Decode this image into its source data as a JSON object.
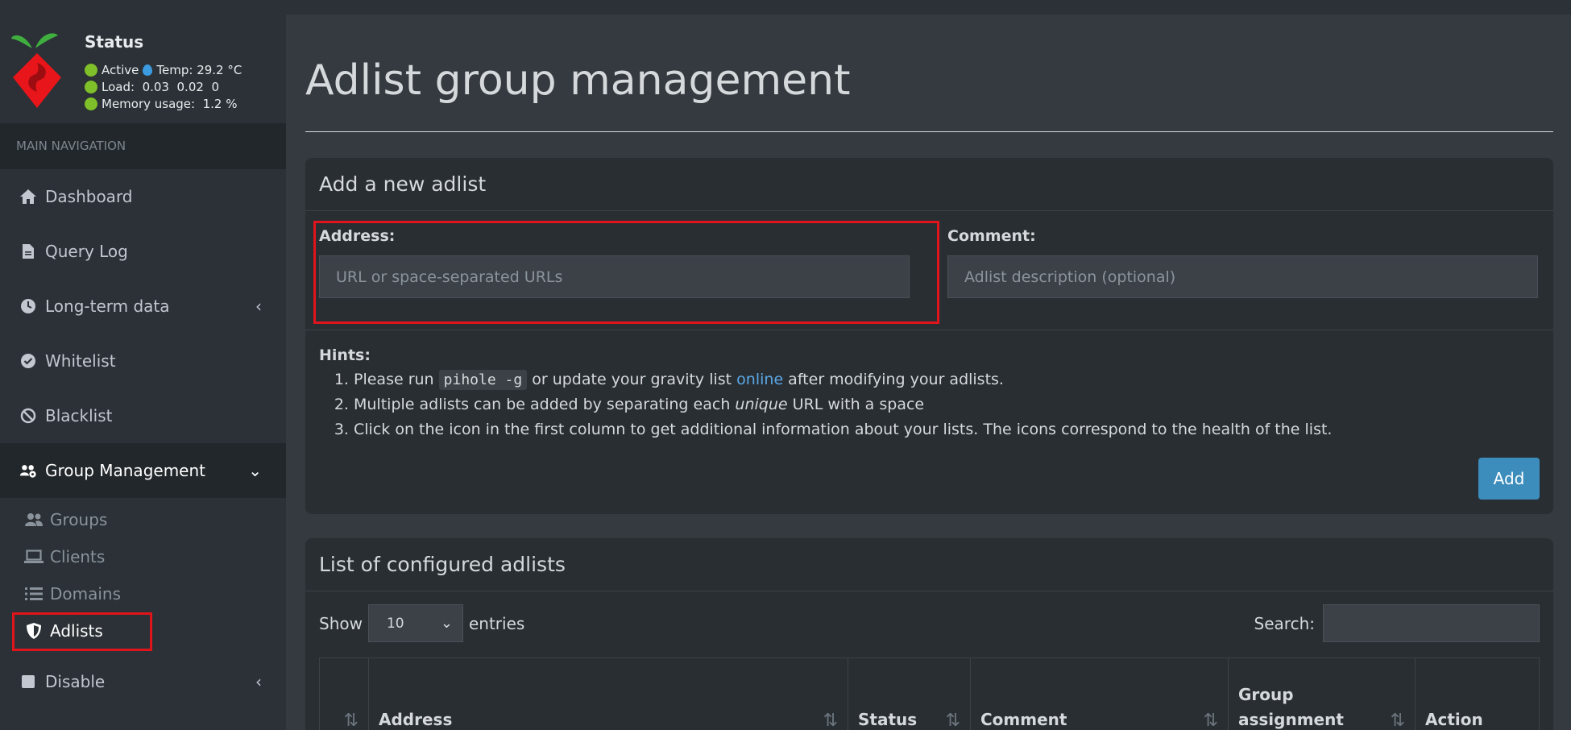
{
  "sidebar": {
    "status": {
      "title": "Status",
      "active": "Active",
      "temp": "Temp: 29.2 °C",
      "load": "Load:  0.03  0.02  0",
      "memory": "Memory usage:  1.2 %"
    },
    "nav_header": "MAIN NAVIGATION",
    "items": [
      {
        "label": "Dashboard",
        "icon": "home-icon"
      },
      {
        "label": "Query Log",
        "icon": "file-icon"
      },
      {
        "label": "Long-term data",
        "icon": "clock-icon"
      },
      {
        "label": "Whitelist",
        "icon": "check-circle-icon"
      },
      {
        "label": "Blacklist",
        "icon": "ban-icon"
      },
      {
        "label": "Group Management",
        "icon": "users-cog-icon"
      }
    ],
    "subitems": [
      {
        "label": "Groups",
        "icon": "users-icon"
      },
      {
        "label": "Clients",
        "icon": "laptop-icon"
      },
      {
        "label": "Domains",
        "icon": "list-icon"
      },
      {
        "label": "Adlists",
        "icon": "shield-icon"
      }
    ],
    "more": [
      {
        "label": "Disable",
        "icon": "square-icon"
      }
    ]
  },
  "main": {
    "title": "Adlist group management",
    "add_card": {
      "title": "Add a new adlist",
      "address_label": "Address:",
      "address_placeholder": "URL or space-separated URLs",
      "comment_label": "Comment:",
      "comment_placeholder": "Adlist description (optional)",
      "hints_label": "Hints:",
      "hint1_a": "Please run ",
      "hint1_code": "pihole -g",
      "hint1_b": " or update your gravity list ",
      "hint1_link": "online",
      "hint1_c": " after modifying your adlists.",
      "hint2_a": "Multiple adlists can be added by separating each ",
      "hint2_em": "unique",
      "hint2_b": " URL with a space",
      "hint3": "Click on the icon in the first column to get additional information about your lists. The icons correspond to the health of the list.",
      "add_button": "Add"
    },
    "list_card": {
      "title": "List of configured adlists",
      "show_label": "Show",
      "entries_value": "10",
      "entries_label": "entries",
      "search_label": "Search:",
      "columns": [
        "Address",
        "Status",
        "Comment",
        "Group assignment",
        "Action"
      ]
    }
  },
  "colors": {
    "accent": "#3c8dbc",
    "highlight": "#e0141b",
    "status_dot": "#7fbf2a"
  }
}
